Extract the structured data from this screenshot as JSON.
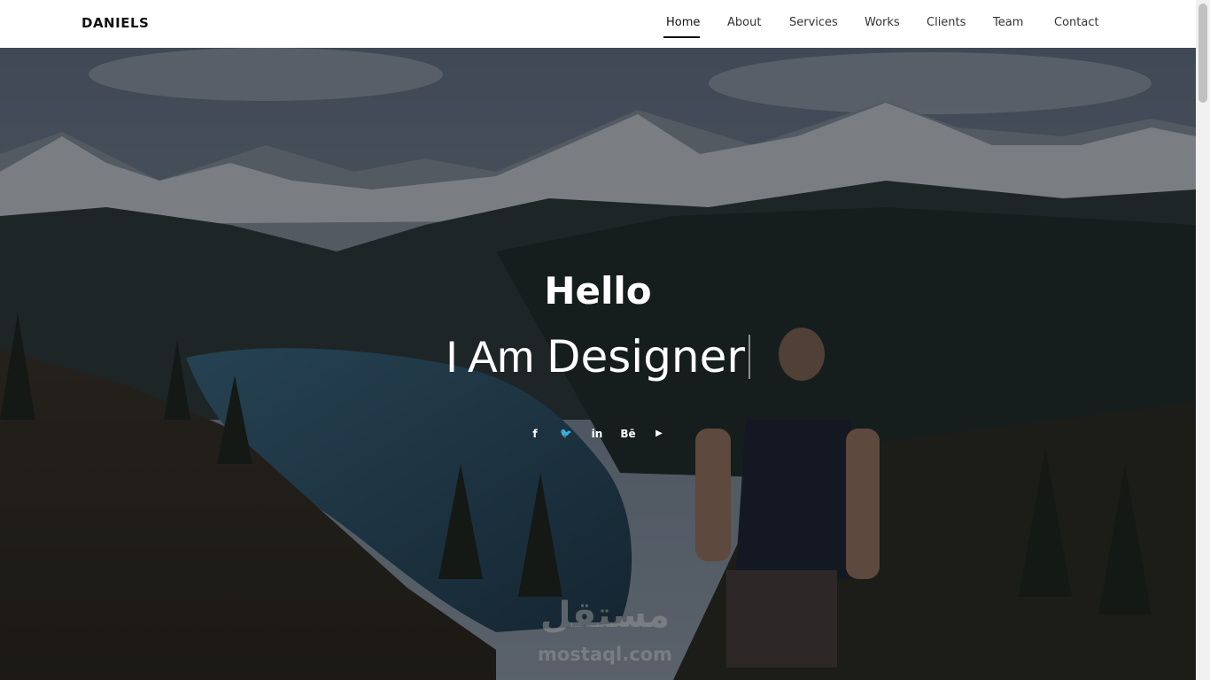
{
  "brand": "DANIELS",
  "nav": {
    "items": [
      {
        "label": "Home",
        "active": true
      },
      {
        "label": "About",
        "active": false
      },
      {
        "label": "Services",
        "active": false
      },
      {
        "label": "Works",
        "active": false
      },
      {
        "label": "Clients",
        "active": false
      },
      {
        "label": "Team",
        "active": false
      },
      {
        "label": "Contact",
        "active": false
      }
    ]
  },
  "hero": {
    "greeting": "Hello",
    "tagline_prefix": "I Am ",
    "tagline_role": "Designer",
    "social": [
      {
        "icon": "facebook-icon",
        "glyph": "f"
      },
      {
        "icon": "twitter-icon",
        "glyph": "🐦"
      },
      {
        "icon": "linkedin-icon",
        "glyph": "in"
      },
      {
        "icon": "behance-icon",
        "glyph": "Bē"
      },
      {
        "icon": "youtube-icon",
        "glyph": "▶"
      }
    ]
  },
  "watermark": {
    "arabic": "مستقل",
    "latin": "mostaql.com"
  },
  "colors": {
    "navbar_bg": "#ffffff",
    "text_dark": "#111111",
    "hero_text": "#ffffff"
  }
}
